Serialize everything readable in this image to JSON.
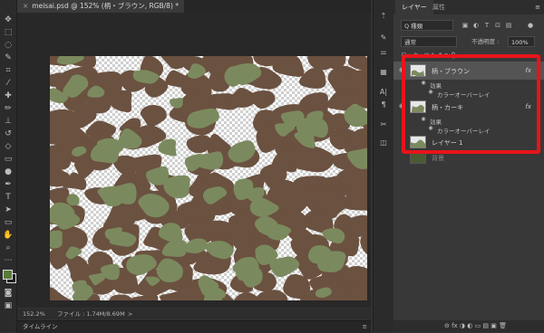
{
  "document_tab": {
    "title": "meisai.psd @ 152% (柄・ブラウン, RGB/8) *",
    "close": "×"
  },
  "status": {
    "zoom": "152.2%",
    "file_info": "ファイル : 1.74M/8.69M",
    "arrow": ">"
  },
  "timeline": {
    "label": "タイムライン"
  },
  "toolbar": {
    "tools": [
      "move-tool",
      "marquee-tool",
      "lasso-tool",
      "quick-select-tool",
      "crop-tool",
      "eyedropper-tool",
      "healing-brush-tool",
      "brush-tool",
      "stamp-tool",
      "history-brush-tool",
      "eraser-tool",
      "gradient-tool",
      "dodge-tool",
      "pen-tool",
      "type-tool",
      "path-select-tool",
      "rectangle-tool",
      "hand-tool",
      "zoom-tool",
      "more-tools"
    ],
    "glyphs": [
      "✥",
      "⬚",
      "◌",
      "✎",
      "⌗",
      "⁄",
      "✚",
      "✏",
      "⊥",
      "↺",
      "◇",
      "▭",
      "●",
      "✒",
      "T",
      "➤",
      "▭",
      "✋",
      "⌕",
      "⋯"
    ]
  },
  "colors": {
    "foreground": "#5a7a3a",
    "background": "#1d1d1d",
    "highlight": "#e8141a",
    "brown": "#6b5140",
    "khaki": "#7b8a5e"
  },
  "panel": {
    "tabs": [
      "レイヤー",
      "属性"
    ],
    "kind_label": "Q 種類",
    "blend_mode": "通常",
    "opacity_label": "不透明度 :",
    "opacity_value": "100%",
    "lock_label": "ロック : ⊞ ✎ ✥ ⌗ 🔒",
    "layers": [
      {
        "name": "柄・ブラウン",
        "fx": "fx",
        "effects_label": "効果",
        "effect": "カラーオーバーレイ"
      },
      {
        "name": "柄・カーキ",
        "fx": "fx",
        "effects_label": "効果",
        "effect": "カラーオーバーレイ"
      },
      {
        "name": "レイヤー 1"
      },
      {
        "name": "背景"
      }
    ],
    "bottom_icons": "⊖ fx ◑ ◐ ▭ ▤ ▣ 🗑"
  }
}
